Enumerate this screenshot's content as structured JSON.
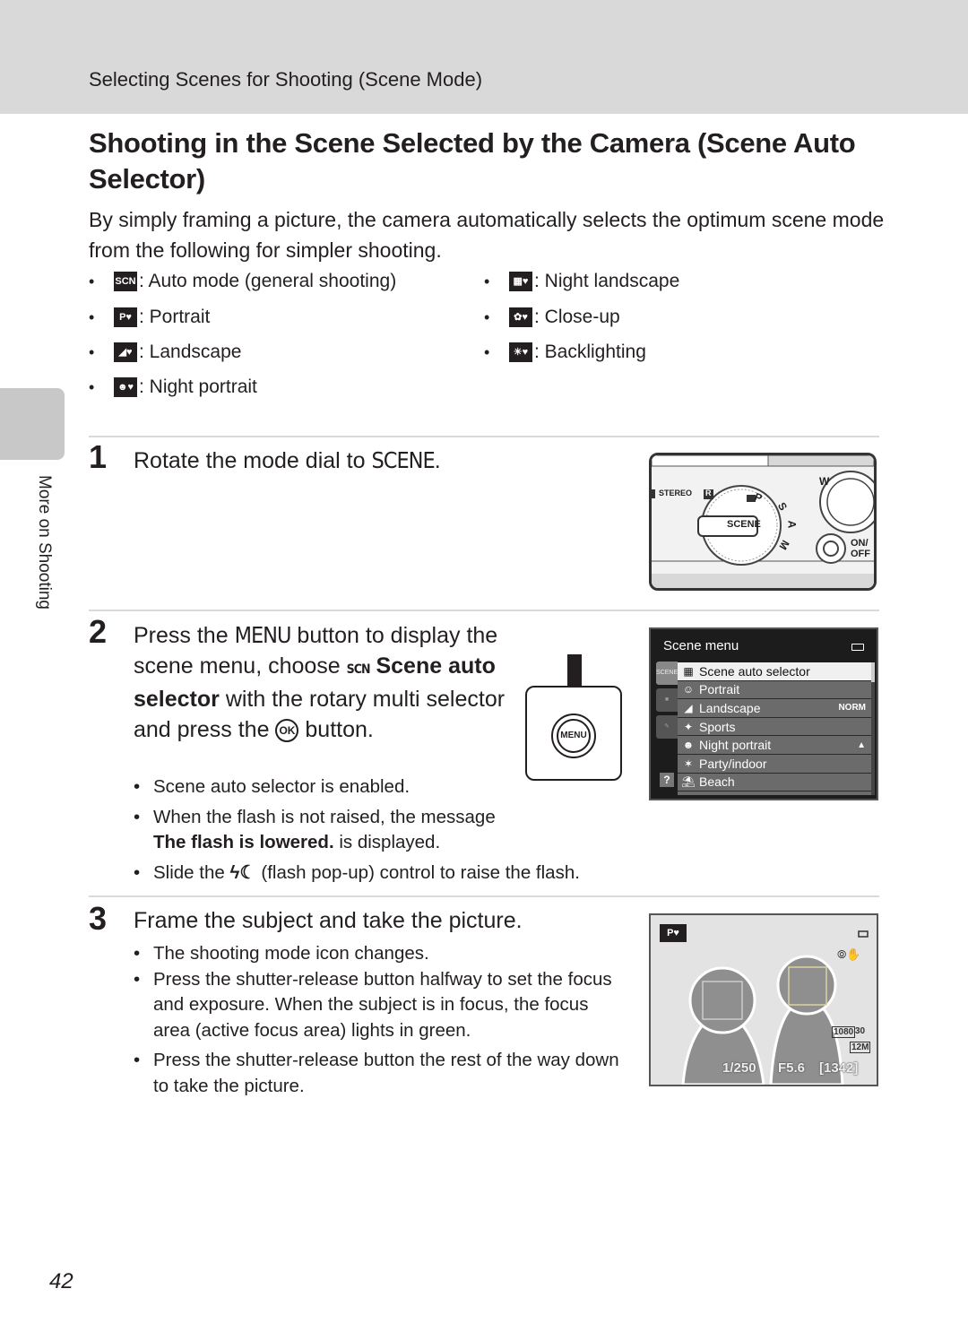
{
  "header": {
    "section_title": "Selecting Scenes for Shooting (Scene Mode)"
  },
  "side_tab": {
    "label": "More on Shooting"
  },
  "page": {
    "title": "Shooting in the Scene Selected by the Camera (Scene Auto Selector)",
    "intro": "By simply framing a picture, the camera automatically selects the optimum scene mode from the following for simpler shooting.",
    "page_number": "42"
  },
  "modes": [
    {
      "icon": "scene-auto-icon",
      "glyph": "SCN",
      "label": ": Auto mode (general shooting)"
    },
    {
      "icon": "portrait-icon",
      "glyph": "P♥",
      "label": ": Portrait"
    },
    {
      "icon": "landscape-icon",
      "glyph": "◢♥",
      "label": ": Landscape"
    },
    {
      "icon": "night-portrait-icon",
      "glyph": "☻♥",
      "label": ": Night portrait"
    },
    {
      "icon": "night-landscape-icon",
      "glyph": "▦♥",
      "label": ": Night landscape"
    },
    {
      "icon": "close-up-icon",
      "glyph": "✿♥",
      "label": ": Close-up"
    },
    {
      "icon": "backlighting-icon",
      "glyph": "☀♥",
      "label": ": Backlighting"
    }
  ],
  "steps": [
    {
      "number": "1",
      "title_pre": "Rotate the mode dial to ",
      "title_glyph": "SCENE",
      "title_post": "."
    },
    {
      "number": "2",
      "title_a": "Press the ",
      "menu_glyph": "MENU",
      "title_b": " button to display the scene menu, choose ",
      "scene_glyph": "SCN",
      "title_bold": " Scene auto selector",
      "title_c": " with the rotary multi selector and press the ",
      "ok_glyph": "OK",
      "title_d": " button.",
      "bullets": {
        "b1": "Scene auto selector is enabled.",
        "b2_pre": "When the flash is not raised, the message ",
        "b2_bold": "The flash is lowered.",
        "b2_post": " is displayed.",
        "b3_pre": "Slide the ",
        "b3_glyph": "ϟ☾",
        "b3_post": " (flash pop-up) control to raise the flash."
      }
    },
    {
      "number": "3",
      "title": "Frame the subject and take the picture.",
      "bullets": [
        "The shooting mode icon changes.",
        "Press the shutter-release button halfway to set the focus and exposure. When the subject is in focus, the focus area (active focus area) lights in green.",
        "Press the shutter-release button the rest of the way down to take the picture."
      ]
    }
  ],
  "camera_dial": {
    "labels": {
      "stereo": "STEREO",
      "r": "R",
      "scene": "SCENE",
      "p": "P",
      "s": "S",
      "a": "A",
      "m": "M",
      "w": "W",
      "on_off": "ON/ OFF"
    }
  },
  "menu_button": {
    "label": "MENU"
  },
  "scene_menu": {
    "title": "Scene menu",
    "tabs": [
      "SCENE",
      "MOVIE",
      "SETUP"
    ],
    "help": "?",
    "items": [
      {
        "icon": "▦",
        "label": "Scene auto selector",
        "extra": "",
        "selected": true
      },
      {
        "icon": "☺",
        "label": "Portrait",
        "extra": ""
      },
      {
        "icon": "◢",
        "label": "Landscape",
        "extra": "NORM"
      },
      {
        "icon": "✦",
        "label": "Sports",
        "extra": ""
      },
      {
        "icon": "☻",
        "label": "Night portrait",
        "extra": "🎥"
      },
      {
        "icon": "✶",
        "label": "Party/indoor",
        "extra": ""
      },
      {
        "icon": "⛱",
        "label": "Beach",
        "extra": ""
      }
    ]
  },
  "viewfinder": {
    "mode_glyph": "P♥",
    "shutter": "1/250",
    "aperture": "F5.6",
    "remaining": "[1342]",
    "movie_res": "1080",
    "fps": "30",
    "image_size": "12M"
  },
  "colors": {
    "header_band": "#d9d9d9",
    "side_tab": "#c8c8c8",
    "text": "#231f20",
    "screen_bg": "#1c1c1c",
    "menu_list_bg": "#6b6b6b"
  }
}
